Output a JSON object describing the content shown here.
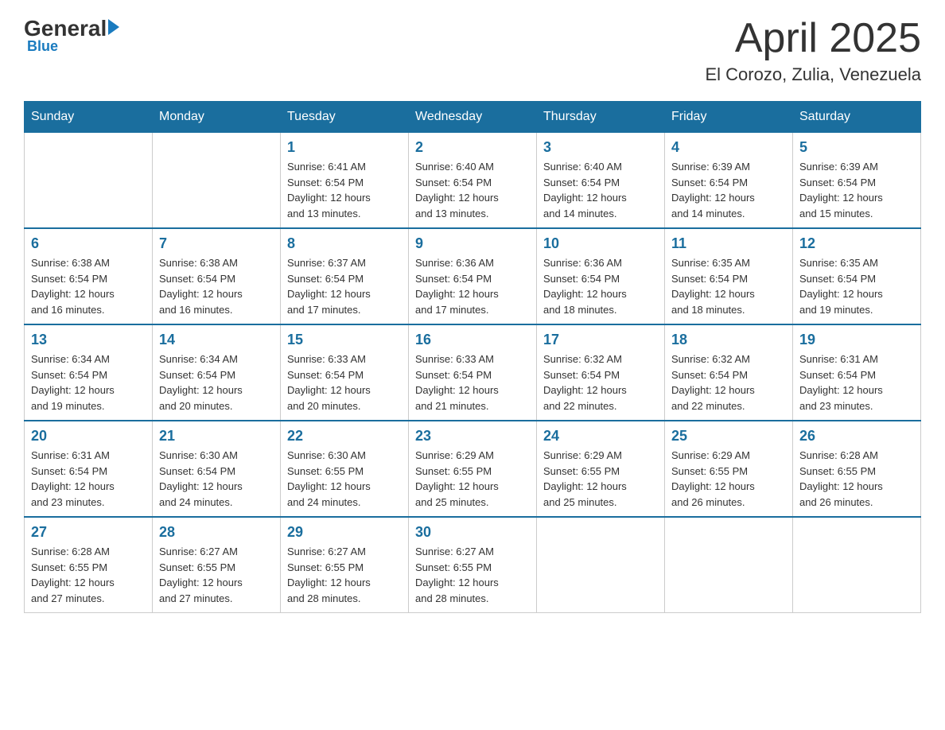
{
  "header": {
    "logo_general": "General",
    "logo_blue": "Blue",
    "month_title": "April 2025",
    "location": "El Corozo, Zulia, Venezuela"
  },
  "days_of_week": [
    "Sunday",
    "Monday",
    "Tuesday",
    "Wednesday",
    "Thursday",
    "Friday",
    "Saturday"
  ],
  "weeks": [
    [
      {
        "day": "",
        "info": ""
      },
      {
        "day": "",
        "info": ""
      },
      {
        "day": "1",
        "info": "Sunrise: 6:41 AM\nSunset: 6:54 PM\nDaylight: 12 hours\nand 13 minutes."
      },
      {
        "day": "2",
        "info": "Sunrise: 6:40 AM\nSunset: 6:54 PM\nDaylight: 12 hours\nand 13 minutes."
      },
      {
        "day": "3",
        "info": "Sunrise: 6:40 AM\nSunset: 6:54 PM\nDaylight: 12 hours\nand 14 minutes."
      },
      {
        "day": "4",
        "info": "Sunrise: 6:39 AM\nSunset: 6:54 PM\nDaylight: 12 hours\nand 14 minutes."
      },
      {
        "day": "5",
        "info": "Sunrise: 6:39 AM\nSunset: 6:54 PM\nDaylight: 12 hours\nand 15 minutes."
      }
    ],
    [
      {
        "day": "6",
        "info": "Sunrise: 6:38 AM\nSunset: 6:54 PM\nDaylight: 12 hours\nand 16 minutes."
      },
      {
        "day": "7",
        "info": "Sunrise: 6:38 AM\nSunset: 6:54 PM\nDaylight: 12 hours\nand 16 minutes."
      },
      {
        "day": "8",
        "info": "Sunrise: 6:37 AM\nSunset: 6:54 PM\nDaylight: 12 hours\nand 17 minutes."
      },
      {
        "day": "9",
        "info": "Sunrise: 6:36 AM\nSunset: 6:54 PM\nDaylight: 12 hours\nand 17 minutes."
      },
      {
        "day": "10",
        "info": "Sunrise: 6:36 AM\nSunset: 6:54 PM\nDaylight: 12 hours\nand 18 minutes."
      },
      {
        "day": "11",
        "info": "Sunrise: 6:35 AM\nSunset: 6:54 PM\nDaylight: 12 hours\nand 18 minutes."
      },
      {
        "day": "12",
        "info": "Sunrise: 6:35 AM\nSunset: 6:54 PM\nDaylight: 12 hours\nand 19 minutes."
      }
    ],
    [
      {
        "day": "13",
        "info": "Sunrise: 6:34 AM\nSunset: 6:54 PM\nDaylight: 12 hours\nand 19 minutes."
      },
      {
        "day": "14",
        "info": "Sunrise: 6:34 AM\nSunset: 6:54 PM\nDaylight: 12 hours\nand 20 minutes."
      },
      {
        "day": "15",
        "info": "Sunrise: 6:33 AM\nSunset: 6:54 PM\nDaylight: 12 hours\nand 20 minutes."
      },
      {
        "day": "16",
        "info": "Sunrise: 6:33 AM\nSunset: 6:54 PM\nDaylight: 12 hours\nand 21 minutes."
      },
      {
        "day": "17",
        "info": "Sunrise: 6:32 AM\nSunset: 6:54 PM\nDaylight: 12 hours\nand 22 minutes."
      },
      {
        "day": "18",
        "info": "Sunrise: 6:32 AM\nSunset: 6:54 PM\nDaylight: 12 hours\nand 22 minutes."
      },
      {
        "day": "19",
        "info": "Sunrise: 6:31 AM\nSunset: 6:54 PM\nDaylight: 12 hours\nand 23 minutes."
      }
    ],
    [
      {
        "day": "20",
        "info": "Sunrise: 6:31 AM\nSunset: 6:54 PM\nDaylight: 12 hours\nand 23 minutes."
      },
      {
        "day": "21",
        "info": "Sunrise: 6:30 AM\nSunset: 6:54 PM\nDaylight: 12 hours\nand 24 minutes."
      },
      {
        "day": "22",
        "info": "Sunrise: 6:30 AM\nSunset: 6:55 PM\nDaylight: 12 hours\nand 24 minutes."
      },
      {
        "day": "23",
        "info": "Sunrise: 6:29 AM\nSunset: 6:55 PM\nDaylight: 12 hours\nand 25 minutes."
      },
      {
        "day": "24",
        "info": "Sunrise: 6:29 AM\nSunset: 6:55 PM\nDaylight: 12 hours\nand 25 minutes."
      },
      {
        "day": "25",
        "info": "Sunrise: 6:29 AM\nSunset: 6:55 PM\nDaylight: 12 hours\nand 26 minutes."
      },
      {
        "day": "26",
        "info": "Sunrise: 6:28 AM\nSunset: 6:55 PM\nDaylight: 12 hours\nand 26 minutes."
      }
    ],
    [
      {
        "day": "27",
        "info": "Sunrise: 6:28 AM\nSunset: 6:55 PM\nDaylight: 12 hours\nand 27 minutes."
      },
      {
        "day": "28",
        "info": "Sunrise: 6:27 AM\nSunset: 6:55 PM\nDaylight: 12 hours\nand 27 minutes."
      },
      {
        "day": "29",
        "info": "Sunrise: 6:27 AM\nSunset: 6:55 PM\nDaylight: 12 hours\nand 28 minutes."
      },
      {
        "day": "30",
        "info": "Sunrise: 6:27 AM\nSunset: 6:55 PM\nDaylight: 12 hours\nand 28 minutes."
      },
      {
        "day": "",
        "info": ""
      },
      {
        "day": "",
        "info": ""
      },
      {
        "day": "",
        "info": ""
      }
    ]
  ]
}
